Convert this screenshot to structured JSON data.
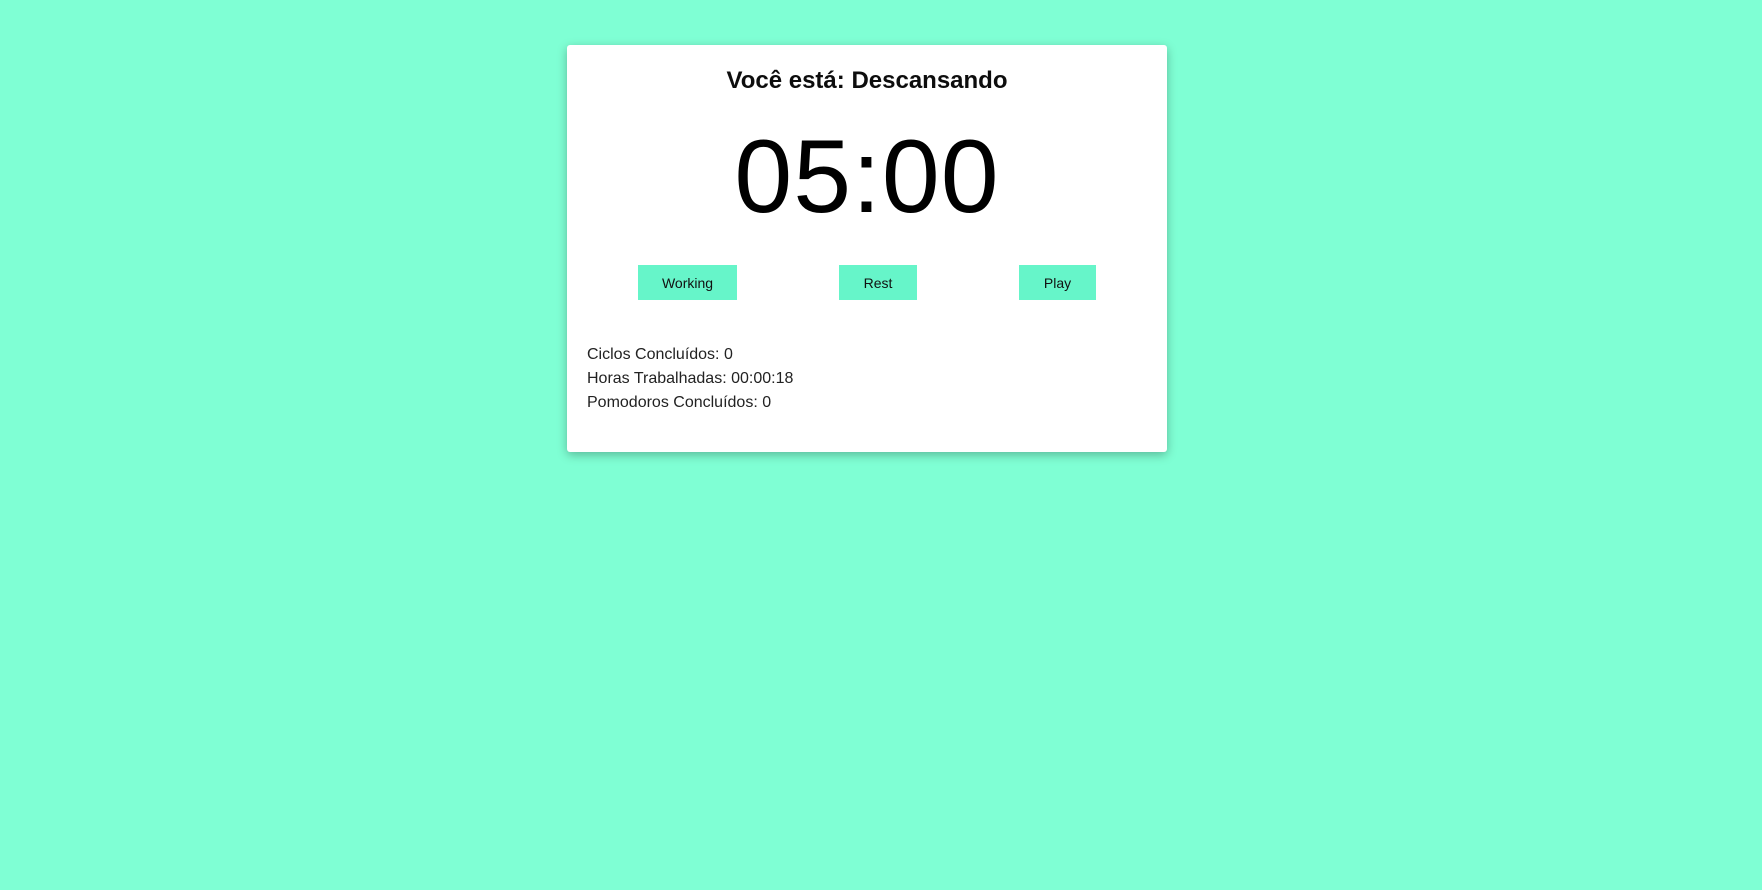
{
  "colors": {
    "background": "#7fffd4",
    "card": "#ffffff",
    "button": "#66f5c9"
  },
  "status": {
    "prefix": "Você está: ",
    "mode": "Descansando"
  },
  "timer": {
    "display": "05:00"
  },
  "buttons": {
    "working": "Working",
    "rest": "Rest",
    "play": "Play"
  },
  "stats": {
    "cycles_label": "Ciclos Concluídos: ",
    "cycles_value": "0",
    "hours_label": "Horas Trabalhadas: ",
    "hours_value": "00:00:18",
    "pomodoros_label": "Pomodoros Concluídos: ",
    "pomodoros_value": "0"
  }
}
